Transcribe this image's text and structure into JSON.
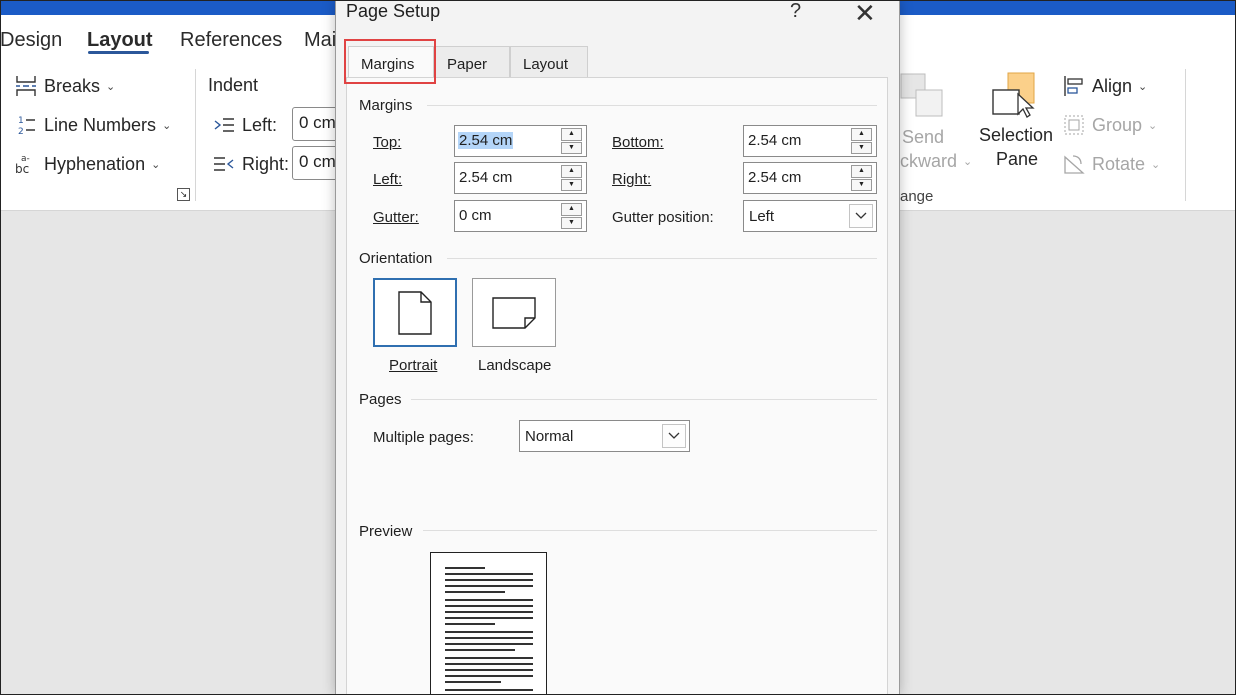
{
  "ribbon": {
    "tabs": [
      "Design",
      "Layout",
      "References",
      "Mai"
    ],
    "active_tab": "Layout",
    "page_setup": {
      "breaks": "Breaks",
      "line_numbers": "Line Numbers",
      "hyphenation": "Hyphenation"
    },
    "indent": {
      "title": "Indent",
      "left_label": "Left:",
      "left_value": "0 cm",
      "right_label": "Right:",
      "right_value": "0 cm"
    },
    "arrange": {
      "send_line1": "Send",
      "send_line2": "ckward",
      "selection_line1": "Selection",
      "selection_line2": "Pane",
      "align": "Align",
      "group": "Group",
      "rotate": "Rotate",
      "group_label": "ange"
    }
  },
  "dialog": {
    "title": "Page Setup",
    "help": "?",
    "tabs": [
      "Margins",
      "Paper",
      "Layout"
    ],
    "active_tab": "Margins",
    "margins": {
      "section": "Margins",
      "top_label": "Top:",
      "top_value": "2.54 cm",
      "bottom_label": "Bottom:",
      "bottom_value": "2.54 cm",
      "left_label": "Left:",
      "left_value": "2.54 cm",
      "right_label": "Right:",
      "right_value": "2.54 cm",
      "gutter_label": "Gutter:",
      "gutter_value": "0 cm",
      "gutter_position_label": "Gutter position:",
      "gutter_position_value": "Left"
    },
    "orientation": {
      "section": "Orientation",
      "portrait": "Portrait",
      "landscape": "Landscape",
      "selected": "Portrait"
    },
    "pages": {
      "section": "Pages",
      "multiple_label": "Multiple pages:",
      "multiple_value": "Normal"
    },
    "preview": {
      "section": "Preview"
    }
  },
  "colors": {
    "title_bar": "#1b5bc6",
    "tab_highlight": "#e04343",
    "selection": "#b4d5f8",
    "accent": "#2b579a"
  }
}
